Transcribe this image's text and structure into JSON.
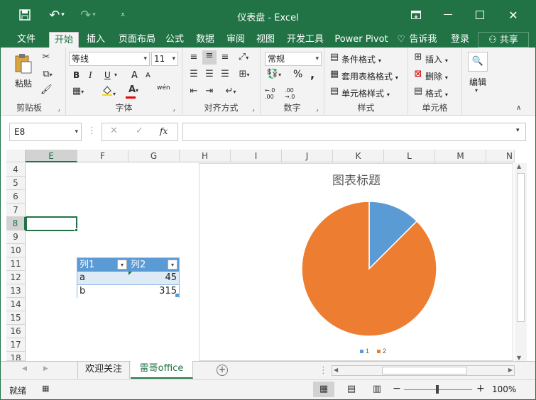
{
  "window": {
    "title": "仪表盘 - Excel"
  },
  "ribbon_tabs": [
    {
      "label": "文件"
    },
    {
      "label": "开始",
      "active": true
    },
    {
      "label": "插入"
    },
    {
      "label": "页面布局"
    },
    {
      "label": "公式"
    },
    {
      "label": "数据"
    },
    {
      "label": "审阅"
    },
    {
      "label": "视图"
    },
    {
      "label": "开发工具"
    },
    {
      "label": "Power Pivot"
    },
    {
      "label": "告诉我"
    },
    {
      "label": "登录"
    },
    {
      "label": "共享"
    }
  ],
  "ribbon": {
    "clipboard": {
      "paste": "粘贴",
      "group": "剪贴板"
    },
    "font": {
      "name": "等线",
      "size": "11",
      "group": "字体",
      "bold": "B",
      "italic": "I",
      "underline": "U",
      "grow": "A",
      "shrink": "A",
      "fill_letter": "A",
      "wen": "wén"
    },
    "alignment": {
      "group": "对齐方式"
    },
    "number": {
      "format": "常规",
      "group": "数字",
      "percent": "%",
      "comma": ",",
      "inc": "←.0 .00",
      "dec": ".00 →.0"
    },
    "styles": {
      "conditional": "条件格式",
      "table": "套用表格格式",
      "cell": "单元格样式",
      "group": "样式"
    },
    "cells": {
      "insert": "插入",
      "delete": "删除",
      "format": "格式",
      "group": "单元格"
    },
    "editing": {
      "label": "编辑"
    }
  },
  "formula_bar": {
    "name_box": "E8",
    "fx": "fx",
    "formula": ""
  },
  "columns": [
    "E",
    "F",
    "G",
    "H",
    "I",
    "J",
    "K",
    "L",
    "M",
    "N"
  ],
  "rows": [
    "4",
    "5",
    "6",
    "7",
    "8",
    "9",
    "10",
    "11",
    "12",
    "13",
    "14",
    "15",
    "16",
    "17",
    "18"
  ],
  "table": {
    "headers": [
      "列1",
      "列2"
    ],
    "rows": [
      [
        "a",
        "45"
      ],
      [
        "b",
        "315"
      ]
    ]
  },
  "chart_data": {
    "type": "pie",
    "title": "图表标题",
    "categories": [
      "1",
      "2"
    ],
    "values": [
      45,
      315
    ],
    "colors": [
      "#5B9BD5",
      "#ED7D31"
    ],
    "legend": "bottom"
  },
  "sheet_tabs": [
    {
      "label": "欢迎关注",
      "active": false
    },
    {
      "label": "雷哥office",
      "active": true
    }
  ],
  "status": {
    "ready": "就绪",
    "zoom": "100%"
  }
}
